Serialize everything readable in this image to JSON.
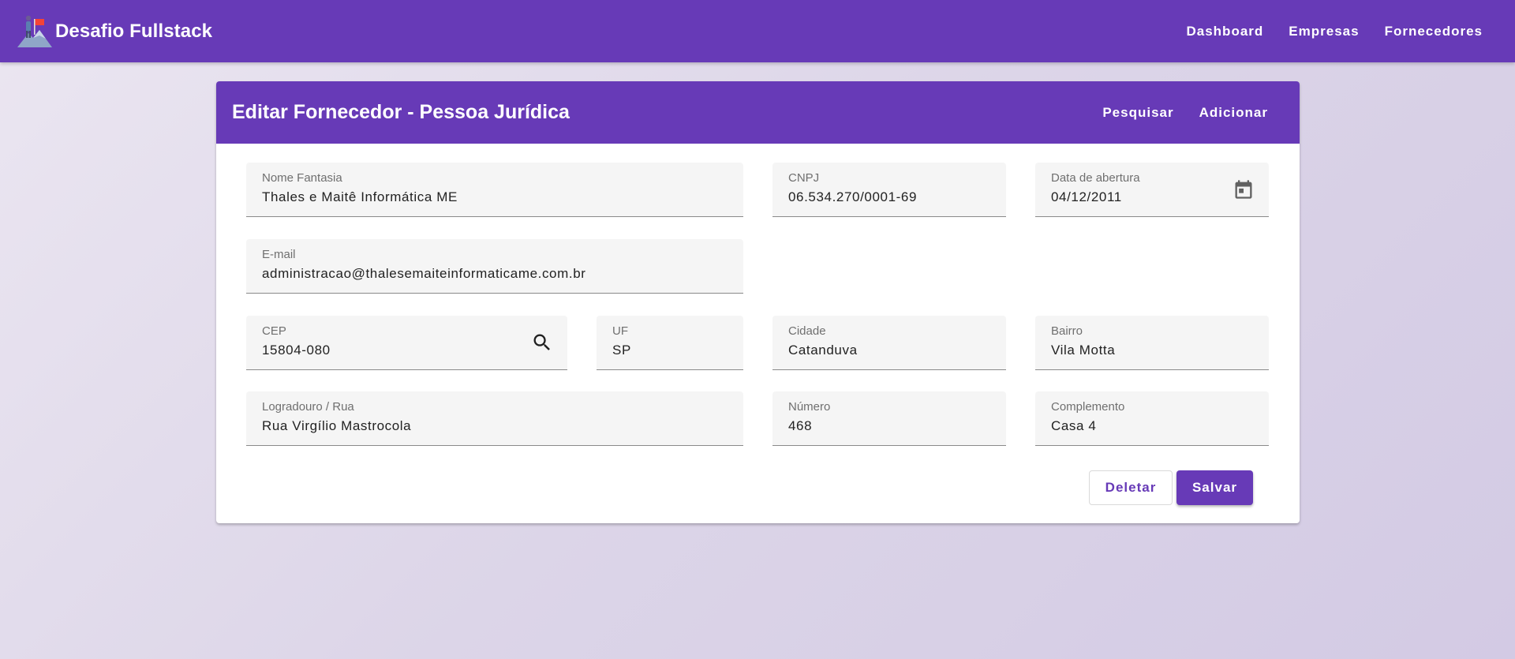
{
  "app": {
    "title": "Desafio Fullstack",
    "nav": [
      "Dashboard",
      "Empresas",
      "Fornecedores"
    ]
  },
  "card": {
    "title": "Editar Fornecedor - Pessoa Jurídica",
    "actions": [
      "Pesquisar",
      "Adicionar"
    ]
  },
  "form": {
    "nome_fantasia": {
      "label": "Nome Fantasia",
      "value": "Thales e Maitê Informática ME"
    },
    "cnpj": {
      "label": "CNPJ",
      "value": "06.534.270/0001-69"
    },
    "data_abertura": {
      "label": "Data de abertura",
      "value": "04/12/2011"
    },
    "email": {
      "label": "E-mail",
      "value": "administracao@thalesemaiteinformaticame.com.br"
    },
    "cep": {
      "label": "CEP",
      "value": "15804-080"
    },
    "uf": {
      "label": "UF",
      "value": "SP"
    },
    "cidade": {
      "label": "Cidade",
      "value": "Catanduva"
    },
    "bairro": {
      "label": "Bairro",
      "value": "Vila Motta"
    },
    "logradouro": {
      "label": "Logradouro / Rua",
      "value": "Rua Virgílio Mastrocola"
    },
    "numero": {
      "label": "Número",
      "value": "468"
    },
    "complemento": {
      "label": "Complemento",
      "value": "Casa 4"
    }
  },
  "buttons": {
    "delete": "Deletar",
    "save": "Salvar"
  },
  "icons": {
    "logo": "mountain-climber-flag-logo",
    "calendar": "calendar-icon",
    "search": "search-icon"
  },
  "colors": {
    "primary": "#673ab7",
    "field_bg": "#f5f5f5"
  }
}
